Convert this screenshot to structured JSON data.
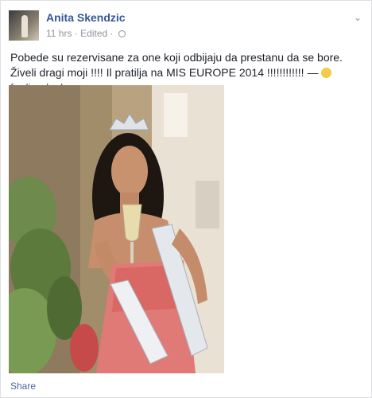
{
  "post": {
    "author": "Anita Skendzic",
    "time": "11 hrs",
    "separator": "·",
    "edited": "Edited",
    "separator2": "·",
    "text": "Pobede su rezervisane za one koji odbijaju da prestanu da se bore. Živeli dragi moji !!!! Il pratilja na MIS EUROPE 2014 !!!!!!!!!!!! —",
    "feeling": "feeling lucky.",
    "chevron": "⌄"
  },
  "actions": {
    "share": "Share"
  },
  "icons": {
    "privacy": "globe-icon",
    "options": "chevron-down-icon",
    "feeling": "smiley-emoji-icon"
  },
  "colors": {
    "link": "#365899",
    "muted": "#90949c",
    "text": "#1d2129"
  }
}
